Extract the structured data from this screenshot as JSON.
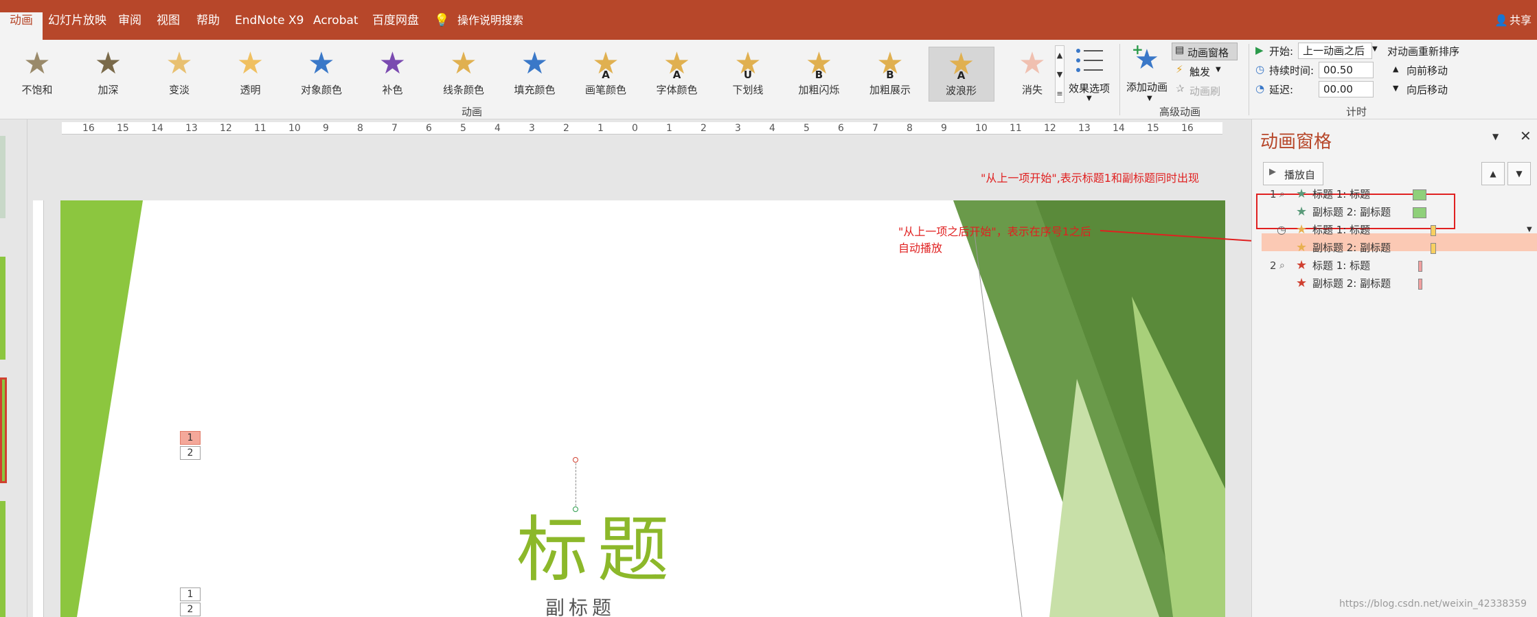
{
  "topbar": {
    "tabs": [
      "动画",
      "幻灯片放映",
      "审阅",
      "视图",
      "帮助",
      "EndNote X9",
      "Acrobat",
      "百度网盘"
    ],
    "search": "操作说明搜索",
    "share": "共享"
  },
  "ribbon": {
    "effects": [
      {
        "label": "不饱和",
        "color": "#9a8a6a"
      },
      {
        "label": "加深",
        "color": "#7a6a4a"
      },
      {
        "label": "变淡",
        "color": "#e8c070"
      },
      {
        "label": "透明",
        "color": "#f0c060"
      },
      {
        "label": "对象颜色",
        "color": "#3a78c8"
      },
      {
        "label": "补色",
        "color": "#7a4ab0"
      },
      {
        "label": "线条颜色",
        "color": "#e0b050"
      },
      {
        "label": "填充颜色",
        "color": "#3a78c8"
      },
      {
        "label": "画笔颜色",
        "color": "#e0b050",
        "glyph": "A"
      },
      {
        "label": "字体颜色",
        "color": "#e0b050",
        "glyph": "A"
      },
      {
        "label": "下划线",
        "color": "#e0b050",
        "glyph": "U"
      },
      {
        "label": "加粗闪烁",
        "color": "#e0b050",
        "glyph": "B"
      },
      {
        "label": "加粗展示",
        "color": "#e0b050",
        "glyph": "B"
      },
      {
        "label": "波浪形",
        "color": "#e0b050",
        "glyph": "A"
      },
      {
        "label": "消失",
        "color": "#f0c0b0"
      }
    ],
    "effect_options": "效果选项",
    "group_animation": "动画",
    "add_animation": "添加动画",
    "animation_pane": "动画窗格",
    "trigger": "触发",
    "animation_painter": "动画刷",
    "group_advanced": "高级动画",
    "start_label": "开始:",
    "start_value": "上一动画之后",
    "duration_label": "持续时间:",
    "duration_value": "00.50",
    "delay_label": "延迟:",
    "delay_value": "00.00",
    "group_timing": "计时",
    "reorder": "对动画重新排序",
    "move_earlier": "向前移动",
    "move_later": "向后移动"
  },
  "ruler": {
    "labels": [
      "16",
      "15",
      "14",
      "13",
      "12",
      "11",
      "10",
      "9",
      "8",
      "7",
      "6",
      "5",
      "4",
      "3",
      "2",
      "1",
      "0",
      "1",
      "2",
      "3",
      "4",
      "5",
      "6",
      "7",
      "8",
      "9",
      "10",
      "11",
      "12",
      "13",
      "14",
      "15",
      "16"
    ]
  },
  "slide": {
    "title": "标题",
    "subtitle": "副标题",
    "chip1": "1",
    "chip2": "2",
    "chip3": "1",
    "chip4": "2"
  },
  "annotations": {
    "top": "\"从上一项开始\",表示标题1和副标题同时出现",
    "mid_line1": "\"从上一项之后开始\"，表示在序号1之后",
    "mid_line2": "自动播放"
  },
  "pane": {
    "title": "动画窗格",
    "play_from": "播放自",
    "rows": [
      {
        "idx": "1",
        "text": "标题 1: 标题",
        "star": "#5a9a7a",
        "bar": "#8fd07a"
      },
      {
        "idx": "",
        "text": "副标题 2: 副标题",
        "star": "#5a9a7a",
        "bar": "#8fd07a"
      },
      {
        "idx": "",
        "text": "标题 1: 标题",
        "star": "#e8b050",
        "bar": "#f8d060"
      },
      {
        "idx": "",
        "text": "副标题 2: 副标题",
        "star": "#e8b050",
        "bar": "#f8d060"
      },
      {
        "idx": "2",
        "text": "标题 1: 标题",
        "star": "#d04030",
        "bar": "#f0a0a0"
      },
      {
        "idx": "",
        "text": "副标题 2: 副标题",
        "star": "#d04030",
        "bar": "#f0a0a0"
      }
    ]
  },
  "watermark": "https://blog.csdn.net/weixin_42338359"
}
